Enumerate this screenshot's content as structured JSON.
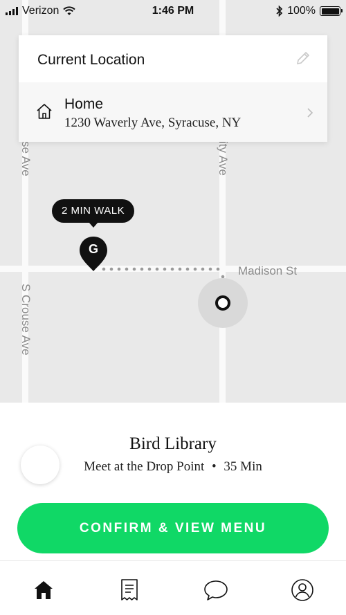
{
  "status_bar": {
    "carrier": "Verizon",
    "time": "1:46 PM",
    "battery": "100%"
  },
  "map": {
    "streets": [
      "se Ave",
      "ity Ave",
      "Madison St",
      "S Crouse Ave"
    ],
    "walk_badge": "2 MIN WALK",
    "pin_letter": "G"
  },
  "location_card": {
    "current_label": "Current Location",
    "saved_name": "Home",
    "saved_address": "1230 Waverly Ave, Syracuse, NY"
  },
  "venue": {
    "name": "Bird Library",
    "meeting": "Meet at the Drop Point",
    "separator": "•",
    "eta": "35 Min"
  },
  "actions": {
    "confirm_label": "CONFIRM & VIEW MENU"
  },
  "tabbar": {
    "items": [
      {
        "icon": "home-icon",
        "active": true
      },
      {
        "icon": "receipt-icon",
        "active": false
      },
      {
        "icon": "chat-icon",
        "active": false
      },
      {
        "icon": "profile-icon",
        "active": false
      }
    ]
  },
  "colors": {
    "accent_green": "#10d866",
    "map_bg": "#e9e9e9",
    "dark": "#111111"
  }
}
